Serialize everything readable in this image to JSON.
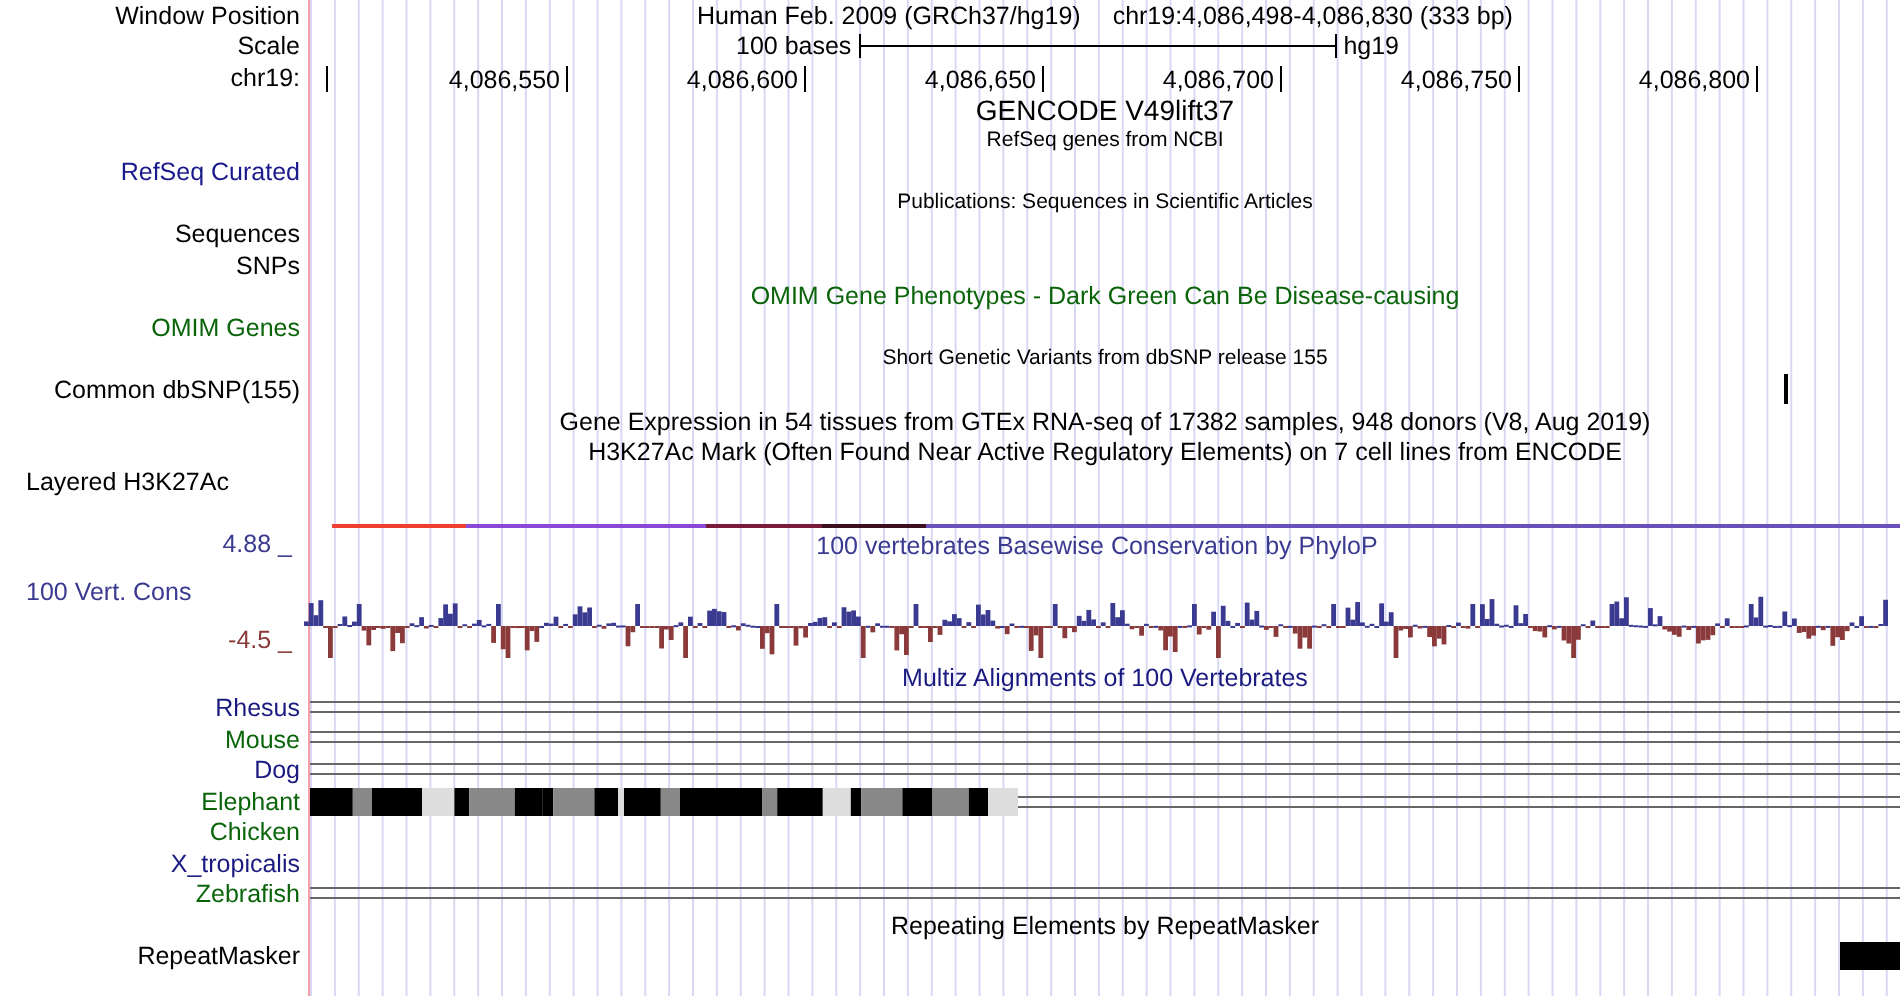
{
  "rows": [
    {
      "kind": "position",
      "label": "Window Position",
      "texts": [
        "Human Feb. 2009 (GRCh37/hg19)",
        "chr19:4,086,498-4,086,830 (333 bp)"
      ]
    },
    {
      "kind": "scale",
      "label": "Scale",
      "length": "100 bases",
      "assembly": "hg19"
    },
    {
      "kind": "ruler",
      "label": "chr19:",
      "ticks": [
        "4,086,550",
        "4,086,600",
        "4,086,650",
        "4,086,700",
        "4,086,750",
        "4,086,800"
      ]
    },
    {
      "kind": "heading",
      "text": "GENCODE V49lift37"
    },
    {
      "kind": "caption",
      "text": "RefSeq genes from NCBI"
    },
    {
      "kind": "label",
      "label": "RefSeq Curated",
      "color": "#1a1a8c"
    },
    {
      "kind": "caption",
      "text": "Publications: Sequences in Scientific Articles"
    },
    {
      "kind": "label",
      "label": "Sequences"
    },
    {
      "kind": "label",
      "label": "SNPs"
    },
    {
      "kind": "title",
      "text": "OMIM Gene Phenotypes - Dark Green Can Be Disease-causing",
      "color": "#0a640a"
    },
    {
      "kind": "label",
      "label": "OMIM Genes",
      "color": "#0a640a"
    },
    {
      "kind": "caption",
      "text": "Short Genetic Variants from dbSNP release 155"
    },
    {
      "kind": "snp",
      "label": "Common dbSNP(155)"
    },
    {
      "kind": "title",
      "text": "Gene Expression in 54 tissues from GTEx RNA-seq of 17382 samples, 948 donors (V8, Aug 2019)"
    },
    {
      "kind": "title",
      "text": "H3K27Ac Mark (Often Found Near Active Regulatory Elements) on 7 cell lines from ENCODE"
    },
    {
      "kind": "layered",
      "label": "Layered H3K27Ac"
    },
    {
      "kind": "wiggle",
      "max": "4.88 _",
      "label": "100 Vert. Cons",
      "min": "-4.5 _",
      "text": "100 vertebrates Basewise Conservation by PhyloP"
    },
    {
      "kind": "title",
      "text": "Multiz Alignments of 100 Vertebrates",
      "color": "#1a1a80"
    },
    {
      "kind": "lines",
      "label": "Rhesus",
      "color": "#1a1a80"
    },
    {
      "kind": "lines",
      "label": "Mouse",
      "color": "#0a640a"
    },
    {
      "kind": "lines",
      "label": "Dog",
      "color": "#1a1a80"
    },
    {
      "kind": "blocks",
      "label": "Elephant",
      "color": "#0a640a"
    },
    {
      "kind": "blank",
      "label": "Chicken",
      "color": "#0a640a"
    },
    {
      "kind": "blank",
      "label": "X_tropicalis",
      "color": "#1a1a80"
    },
    {
      "kind": "lines",
      "label": "Zebrafish",
      "color": "#0a640a"
    },
    {
      "kind": "title",
      "text": "Repeating Elements by RepeatMasker"
    },
    {
      "kind": "repeat",
      "label": "RepeatMasker"
    }
  ]
}
